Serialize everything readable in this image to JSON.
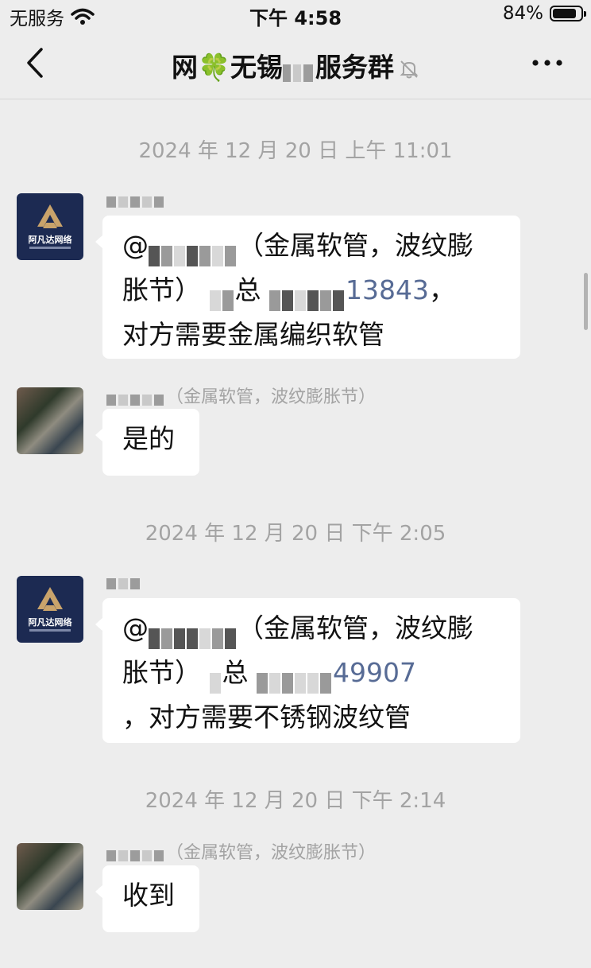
{
  "status_bar": {
    "carrier": "无服务",
    "time": "下午 4:58",
    "battery_percent": "84%",
    "battery_level": 0.84
  },
  "nav": {
    "title": "网🍀无锡",
    "title_suffix": "服务群",
    "icons": [
      "back-chevron-icon",
      "mute-bell-icon",
      "more-dots-icon"
    ]
  },
  "messages": [
    {
      "timestamp": "2024 年 12 月 20 日 上午 11:01",
      "sender_name": "",
      "avatar": "阿凡达网络",
      "lines": [
        "（金属软管，波纹膨",
        "胀节）",
        "总",
        "13843",
        "，",
        "对方需要金属编织软管"
      ]
    },
    {
      "sender_name": "（金属软管，波纹膨胀节）",
      "text": "是的"
    },
    {
      "timestamp": "2024 年 12 月 20 日 下午 2:05",
      "sender_name": "",
      "avatar": "阿凡达网络",
      "lines": [
        "（金属软管，波纹膨",
        "胀节）",
        "总",
        "49907",
        "，对方需要不锈钢波纹管"
      ]
    },
    {
      "timestamp": "2024 年 12 月 20 日 下午 2:14",
      "sender_name": "（金属软管，波纹膨胀节）",
      "text": "收到"
    }
  ],
  "colors": {
    "background": "#ededed",
    "bubble": "#ffffff",
    "link": "#576b95",
    "timestamp": "#a3a3a3",
    "brand_avatar": "#1c2a52"
  }
}
